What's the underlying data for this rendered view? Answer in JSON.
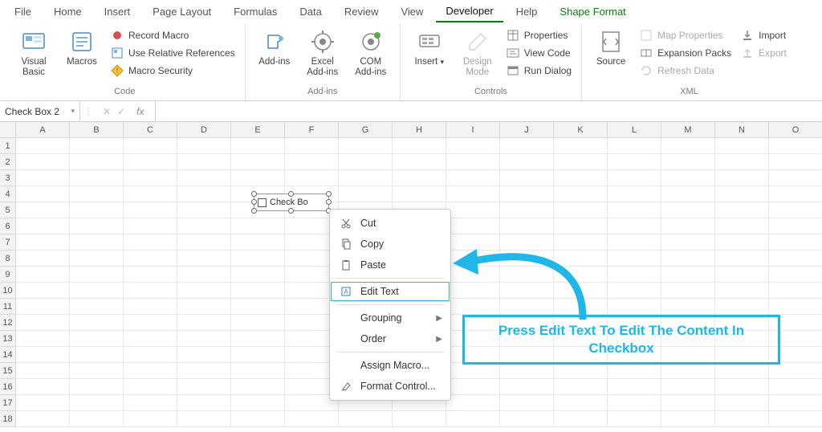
{
  "tabs": {
    "file": "File",
    "home": "Home",
    "insert": "Insert",
    "page_layout": "Page Layout",
    "formulas": "Formulas",
    "data": "Data",
    "review": "Review",
    "view": "View",
    "developer": "Developer",
    "help": "Help",
    "shape_format": "Shape Format"
  },
  "ribbon": {
    "code": {
      "label": "Code",
      "visual_basic": "Visual Basic",
      "macros": "Macros",
      "record_macro": "Record Macro",
      "use_relative": "Use Relative References",
      "macro_security": "Macro Security"
    },
    "addins": {
      "label": "Add-ins",
      "addins": "Add-ins",
      "excel_addins": "Excel Add-ins",
      "com_addins": "COM Add-ins"
    },
    "controls": {
      "label": "Controls",
      "insert": "Insert",
      "design_mode": "Design Mode",
      "properties": "Properties",
      "view_code": "View Code",
      "run_dialog": "Run Dialog"
    },
    "xml": {
      "label": "XML",
      "source": "Source",
      "map_properties": "Map Properties",
      "expansion_packs": "Expansion Packs",
      "refresh_data": "Refresh Data",
      "import": "Import",
      "export": "Export"
    }
  },
  "formula_bar": {
    "name_box": "Check Box 2",
    "fx": "fx"
  },
  "columns": [
    "A",
    "B",
    "C",
    "D",
    "E",
    "F",
    "G",
    "H",
    "I",
    "J",
    "K",
    "L",
    "M",
    "N",
    "O"
  ],
  "rows": [
    "1",
    "2",
    "3",
    "4",
    "5",
    "6",
    "7",
    "8",
    "9",
    "10",
    "11",
    "12",
    "13",
    "14",
    "15",
    "16",
    "17",
    "18"
  ],
  "checkbox": {
    "label": "Check Bo"
  },
  "context_menu": {
    "cut": "Cut",
    "copy": "Copy",
    "paste": "Paste",
    "edit_text": "Edit Text",
    "grouping": "Grouping",
    "order": "Order",
    "assign_macro": "Assign Macro...",
    "format_control": "Format Control..."
  },
  "callout": {
    "text": "Press Edit Text To Edit The Content In Checkbox"
  }
}
